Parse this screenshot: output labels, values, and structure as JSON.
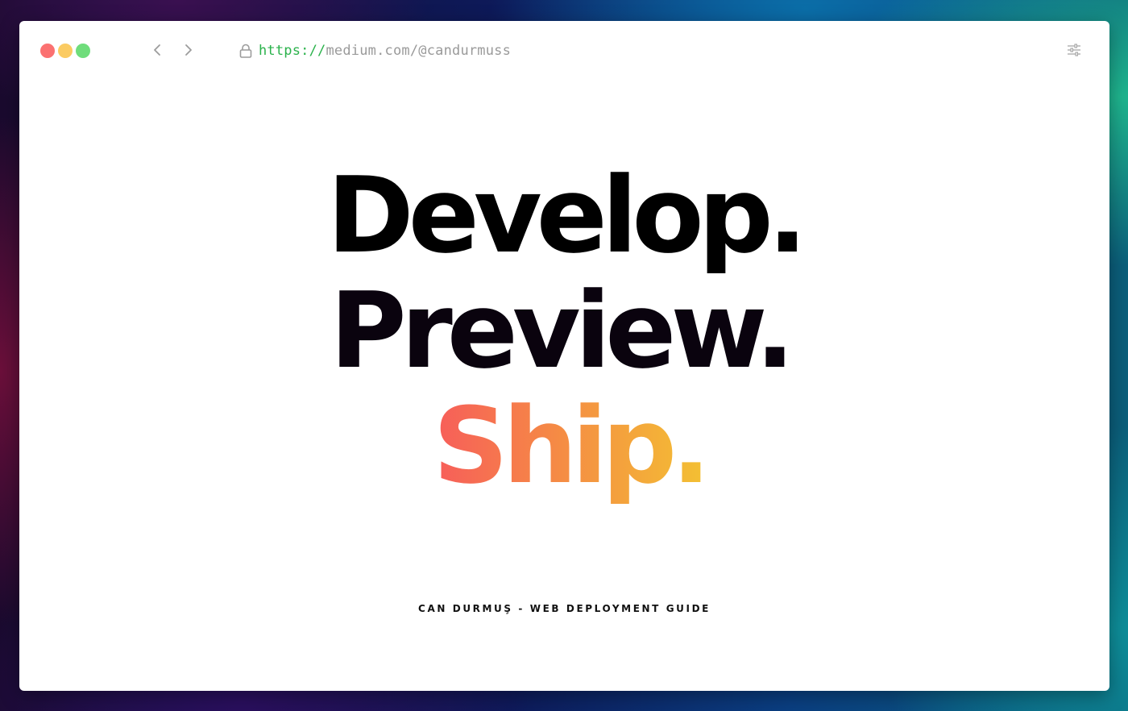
{
  "browser": {
    "url_scheme": "https://",
    "url_rest": "medium.com/@candurmuss",
    "traffic_colors": {
      "close": "#fb7171",
      "minimize": "#fbcb62",
      "maximize": "#6fdd7b"
    },
    "icons": {
      "back": "chevron-left-icon",
      "forward": "chevron-right-icon",
      "lock": "lock-icon",
      "settings": "sliders-icon"
    }
  },
  "hero": {
    "line1": "Develop.",
    "line2": "Preview.",
    "line3": "Ship.",
    "gradient_colors": [
      "#f75b5b",
      "#f58a45",
      "#f3c232"
    ]
  },
  "byline": "CAN DURMUŞ - WEB DEPLOYMENT GUIDE"
}
